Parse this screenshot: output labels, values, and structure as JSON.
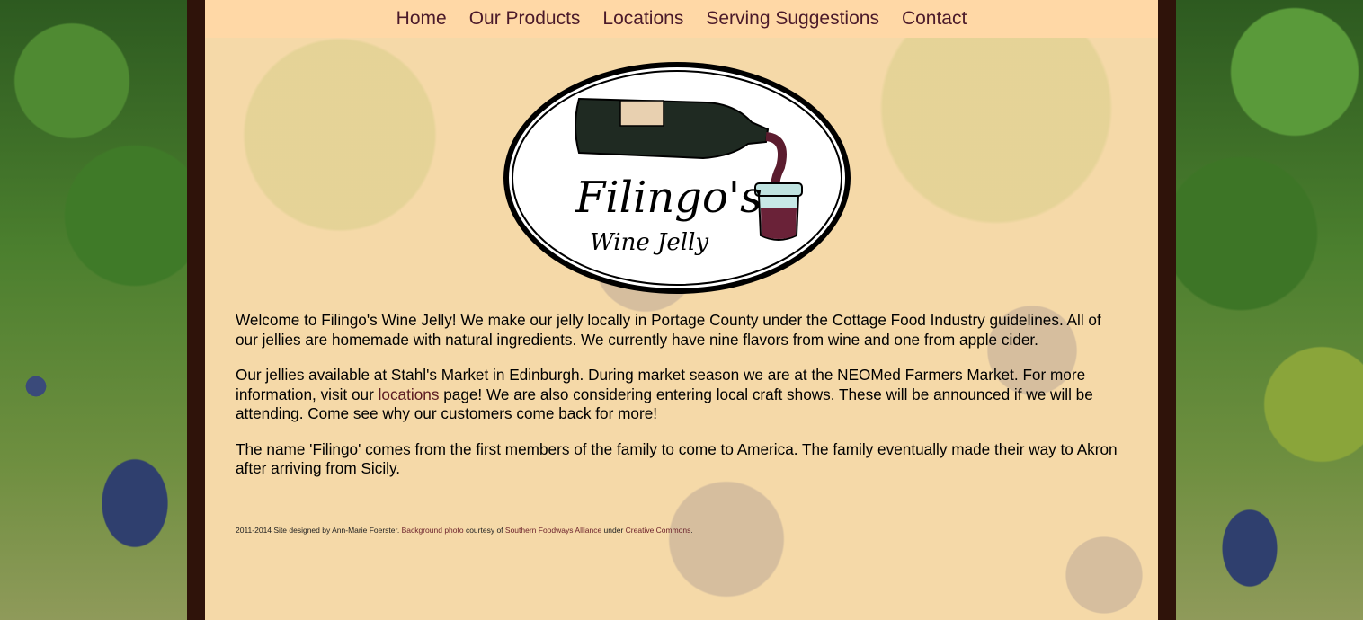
{
  "nav": {
    "items": [
      "Home",
      "Our Products",
      "Locations",
      "Serving Suggestions",
      "Contact"
    ]
  },
  "logo": {
    "line1": "Filingo's",
    "line2": "Wine Jelly"
  },
  "intro": {
    "p1": "Welcome to Filingo's Wine Jelly! We make our jelly locally in Portage County under the Cottage Food Industry guidelines. All of our jellies are homemade with natural ingredients. We currently have nine flavors from wine and one from apple cider.",
    "p2_before": "Our jellies available at Stahl's Market in Edinburgh. During market season we are at the NEOMed Farmers Market. For more information, visit our ",
    "p2_link": "locations",
    "p2_after": " page! We are also considering entering local craft shows. These will be announced if we will be attending. Come see why our customers come back for more!",
    "p3": "The name 'Filingo' comes from the first members of the family to come to America. The family eventually made their way to Akron after arriving from Sicily."
  },
  "footer": {
    "prefix": "2011-2014 Site designed by Ann-Marie Foerster. ",
    "bg_link": "Background photo",
    "courtesy": " courtesy of ",
    "sfa_link": "Southern Foodways Alliance",
    "under": " under ",
    "cc_link": "Creative Commons",
    "end": "."
  },
  "colors": {
    "nav_bg": "#ffd8a6",
    "nav_text": "#4b1a2a",
    "frame": "#2f130a",
    "link": "#5a1a22"
  }
}
